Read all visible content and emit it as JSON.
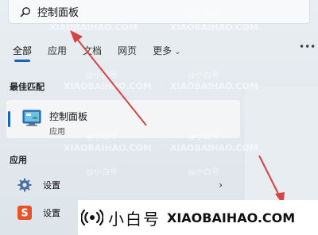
{
  "search": {
    "value": "控制面板"
  },
  "tabs": [
    {
      "label": "全部",
      "active": true
    },
    {
      "label": "应用"
    },
    {
      "label": "文档"
    },
    {
      "label": "网页"
    },
    {
      "label": "更多"
    }
  ],
  "tabs_more_chevron": "⌄",
  "overflow_dots": "•••",
  "best_match": {
    "section_label": "最佳匹配",
    "title": "控制面板",
    "subtitle": "应用",
    "icon": "control-panel-icon"
  },
  "apps": {
    "section_label": "应用",
    "items": [
      {
        "label": "设置",
        "icon": "gear-icon",
        "arrow": "›"
      },
      {
        "label": "设置",
        "icon": "sogou-icon"
      }
    ]
  },
  "watermark": {
    "handle": "@小白号",
    "site": "XIAOBAIHAO.COM"
  },
  "banner": {
    "brand_cn": "小白号",
    "brand_en": "XIAOBAIHAO.COM"
  },
  "colors": {
    "accent": "#1c63b6",
    "annotation_arrow": "#d64541",
    "sogou": "#e8542a"
  }
}
